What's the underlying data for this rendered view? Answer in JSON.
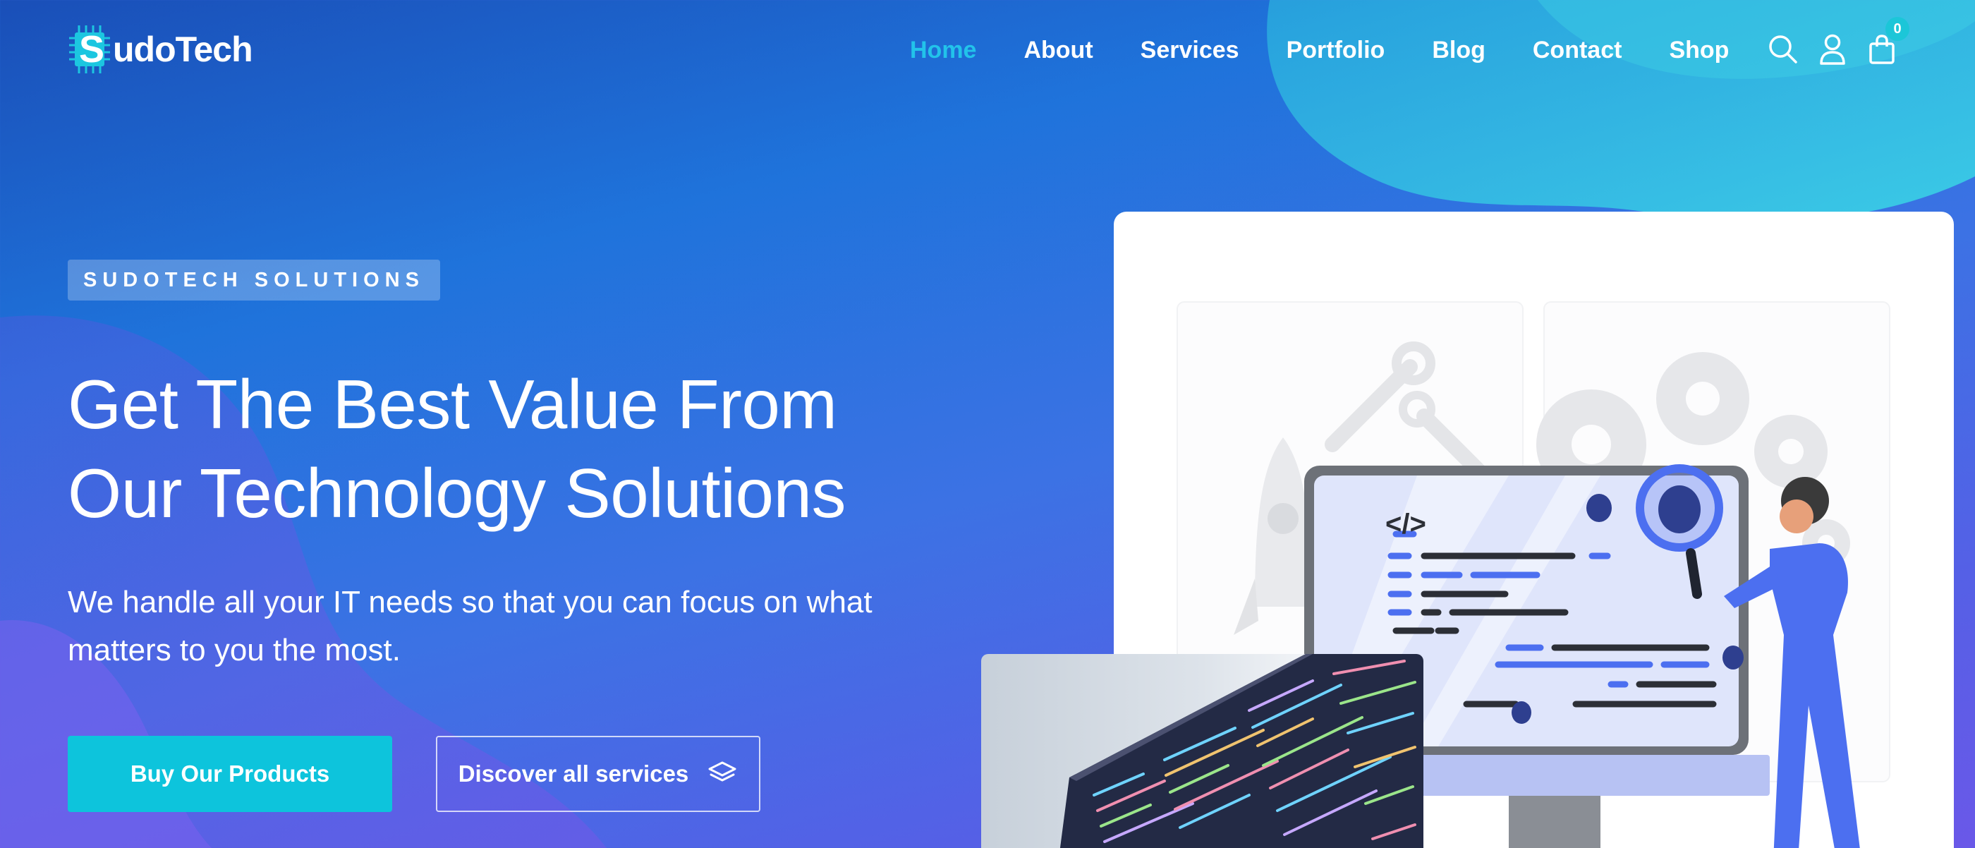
{
  "brand": {
    "logo_letter": "S",
    "name": "udoTech"
  },
  "nav": {
    "items": [
      {
        "label": "Home",
        "active": true
      },
      {
        "label": "About",
        "active": false
      },
      {
        "label": "Services",
        "active": false
      },
      {
        "label": "Portfolio",
        "active": false
      },
      {
        "label": "Blog",
        "active": false
      },
      {
        "label": "Contact",
        "active": false
      },
      {
        "label": "Shop",
        "active": false
      }
    ]
  },
  "header_icons": {
    "search": "search-icon",
    "account": "user-icon",
    "cart": "shopping-bag-icon",
    "cart_count": "0"
  },
  "hero": {
    "tagline": "SUDOTECH SOLUTIONS",
    "headline_line1": "Get The Best Value From",
    "headline_line2": "Our Technology Solutions",
    "subtext": "We handle all your IT needs so that you can focus on what matters to you the most.",
    "primary_button": "Buy Our Products",
    "secondary_button": "Discover all services",
    "secondary_button_icon": "layers-icon"
  },
  "illustration": {
    "code_tag": "</>"
  },
  "colors": {
    "accent": "#0dc4dc",
    "nav_active": "#22c3ea",
    "background_top": "#1a4fb8",
    "background_bottom": "#6a58e8"
  }
}
